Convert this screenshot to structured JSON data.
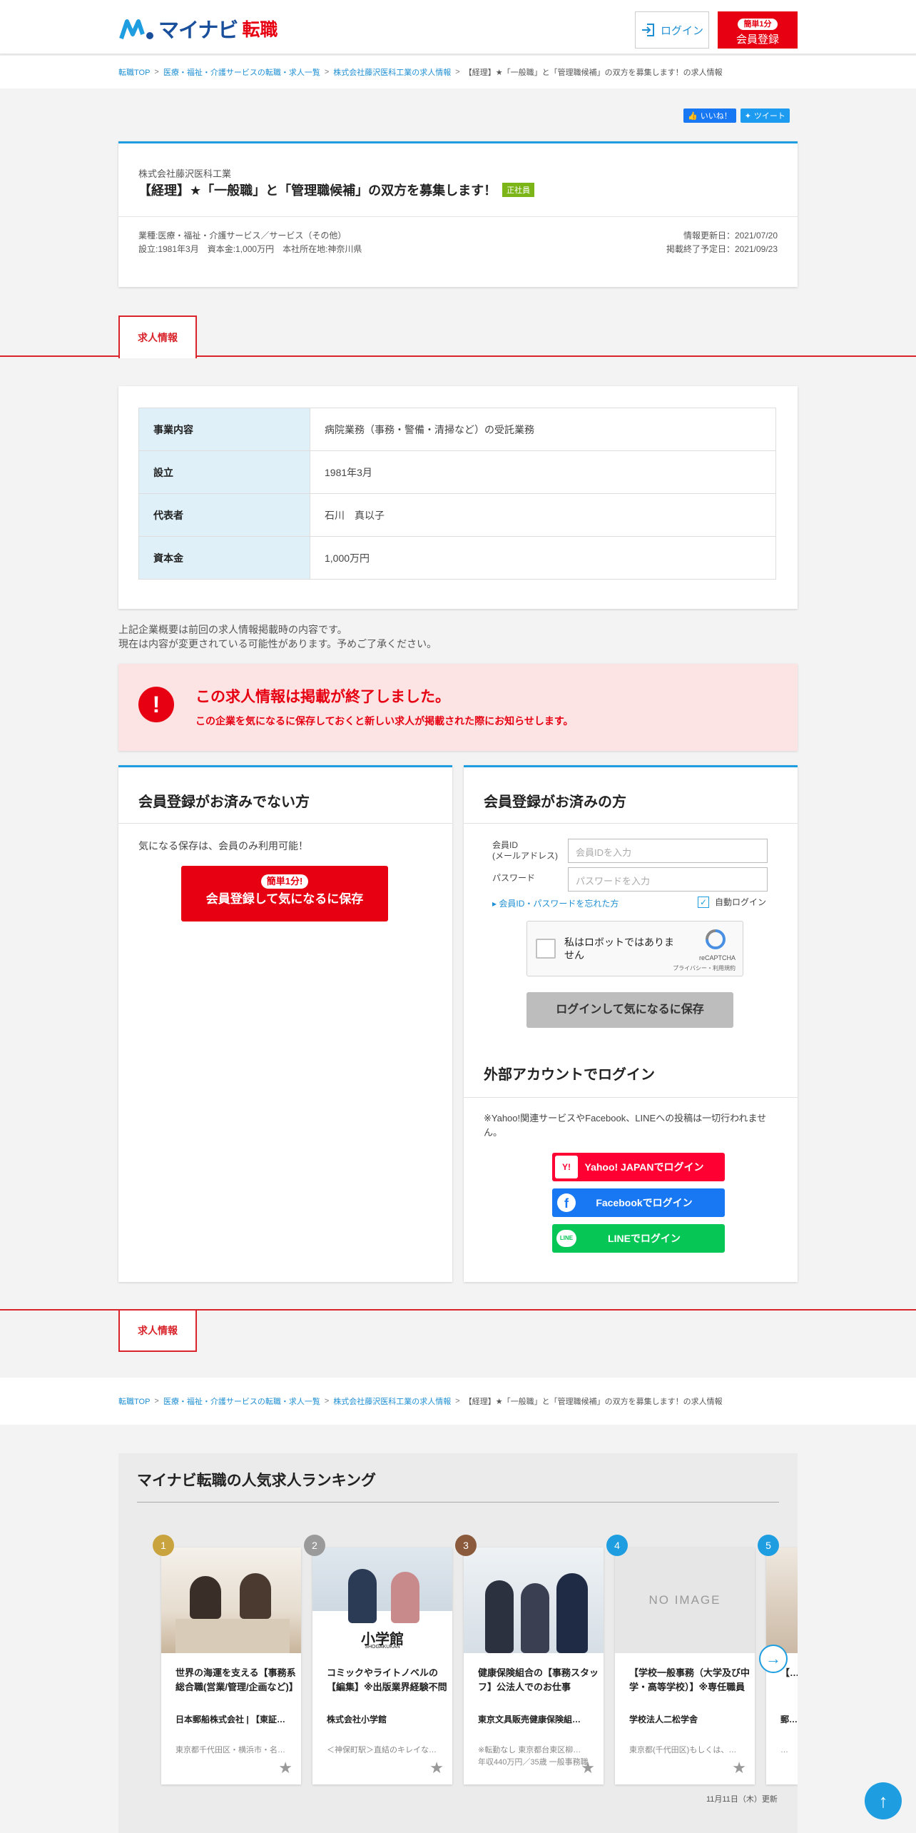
{
  "header": {
    "logo_brand": "マイナビ",
    "logo_sub": "転職",
    "login_label": "ログイン",
    "register_pill": "簡単1分",
    "register_label": "会員登録"
  },
  "breadcrumb": {
    "items": [
      "転職TOP",
      "医療・福祉・介護サービスの転職・求人一覧",
      "株式会社藤沢医科工業の求人情報"
    ],
    "current": "【経理】★「一般職」と「管理職候補」の双方を募集します！の求人情報",
    "sep": ">"
  },
  "social": {
    "like": "いいね！",
    "tweet": "ツイート"
  },
  "job": {
    "company": "株式会社藤沢医科工業",
    "title": "【経理】★「一般職」と「管理職候補」の双方を募集します！",
    "employment_type": "正社員",
    "meta_line1": "業種:医療・福祉・介護サービス／サービス（その他）",
    "meta_line2": "設立:1981年3月　資本金:1,000万円　本社所在地:神奈川県",
    "updated": "情報更新日：2021/07/20",
    "closing": "掲載終了予定日：2021/09/23"
  },
  "tab_label": "求人情報",
  "company_info": [
    {
      "key": "事業内容",
      "value": "病院業務（事務・警備・清掃など）の受託業務"
    },
    {
      "key": "設立",
      "value": "1981年3月"
    },
    {
      "key": "代表者",
      "value": "石川　真以子"
    },
    {
      "key": "資本金",
      "value": "1,000万円"
    }
  ],
  "notice": {
    "line1": "上記企業概要は前回の求人情報掲載時の内容です。",
    "line2": "現在は内容が変更されている可能性があります。予めご了承ください。"
  },
  "ended": {
    "icon": "!",
    "title": "この求人情報は掲載が終了しました。",
    "sub": "この企業を気になるに保存しておくと新しい求人が掲載された際にお知らせします。"
  },
  "nonmember": {
    "heading": "会員登録がお済みでない方",
    "desc": "気になる保存は、会員のみ利用可能！",
    "btn_pill": "簡単1分!",
    "btn_label": "会員登録して気になるに保存"
  },
  "member": {
    "heading": "会員登録がお済みの方",
    "id_label_1": "会員ID",
    "id_label_2": "(メールアドレス)",
    "id_placeholder": "会員IDを入力",
    "pw_label": "パスワード",
    "pw_placeholder": "パスワードを入力",
    "forgot": "会員ID・パスワードを忘れた方",
    "auto_login": "自動ログイン",
    "captcha_text": "私はロボットではありません",
    "captcha_brand": "reCAPTCHA",
    "captcha_links": "プライバシー・利用規約",
    "login_btn": "ログインして気になるに保存",
    "external_heading": "外部アカウントでログイン",
    "external_note": "※Yahoo!関連サービスやFacebook、LINEへの投稿は一切行われません。",
    "yahoo": "Yahoo! JAPANでログイン",
    "facebook": "Facebookでログイン",
    "line": "LINEでログイン",
    "line_icon": "LINE"
  },
  "ranking": {
    "heading": "マイナビ転職の人気求人ランキング",
    "updated": "11月11日（木）更新",
    "items": [
      {
        "rank": "1",
        "title": "世界の海運を支える【事務系総合職(営業/管理/企画など)】",
        "company": "日本郵船株式会社 | 【東証…",
        "loc": "東京都千代田区・横浜市・名…",
        "color": "#c9a33d"
      },
      {
        "rank": "2",
        "title": "コミックやライトノベルの【編集】※出版業界経験不問",
        "company": "株式会社小学館",
        "loc": "＜神保町駅＞直結のキレイな…",
        "color": "#9a9a9a",
        "img_text": "小学館",
        "img_sub": "SHOGAKUKAN"
      },
      {
        "rank": "3",
        "title": "健康保険組合の【事務スタッフ】公法人でのお仕事",
        "company": "東京文具販売健康保険組…",
        "loc": "※転勤なし 東京都台東区柳…",
        "loc2": "年収440万円／35歳 一般事務職",
        "color": "#8b5a3c"
      },
      {
        "rank": "4",
        "title": "【学校一般事務（大学及び中学・高等学校）】※専任職員",
        "company": "学校法人二松学舎",
        "loc": "東京都(千代田区)もしくは、…",
        "color": "#1e9ee0",
        "img_text": "NO IMAGE"
      },
      {
        "rank": "5",
        "title": "【…",
        "company": "郵…",
        "loc": "…",
        "color": "#1e9ee0"
      }
    ]
  },
  "colors": {
    "accent": "#1e9ee0",
    "brand_red": "#e60012",
    "tab_red": "#d9242c"
  }
}
